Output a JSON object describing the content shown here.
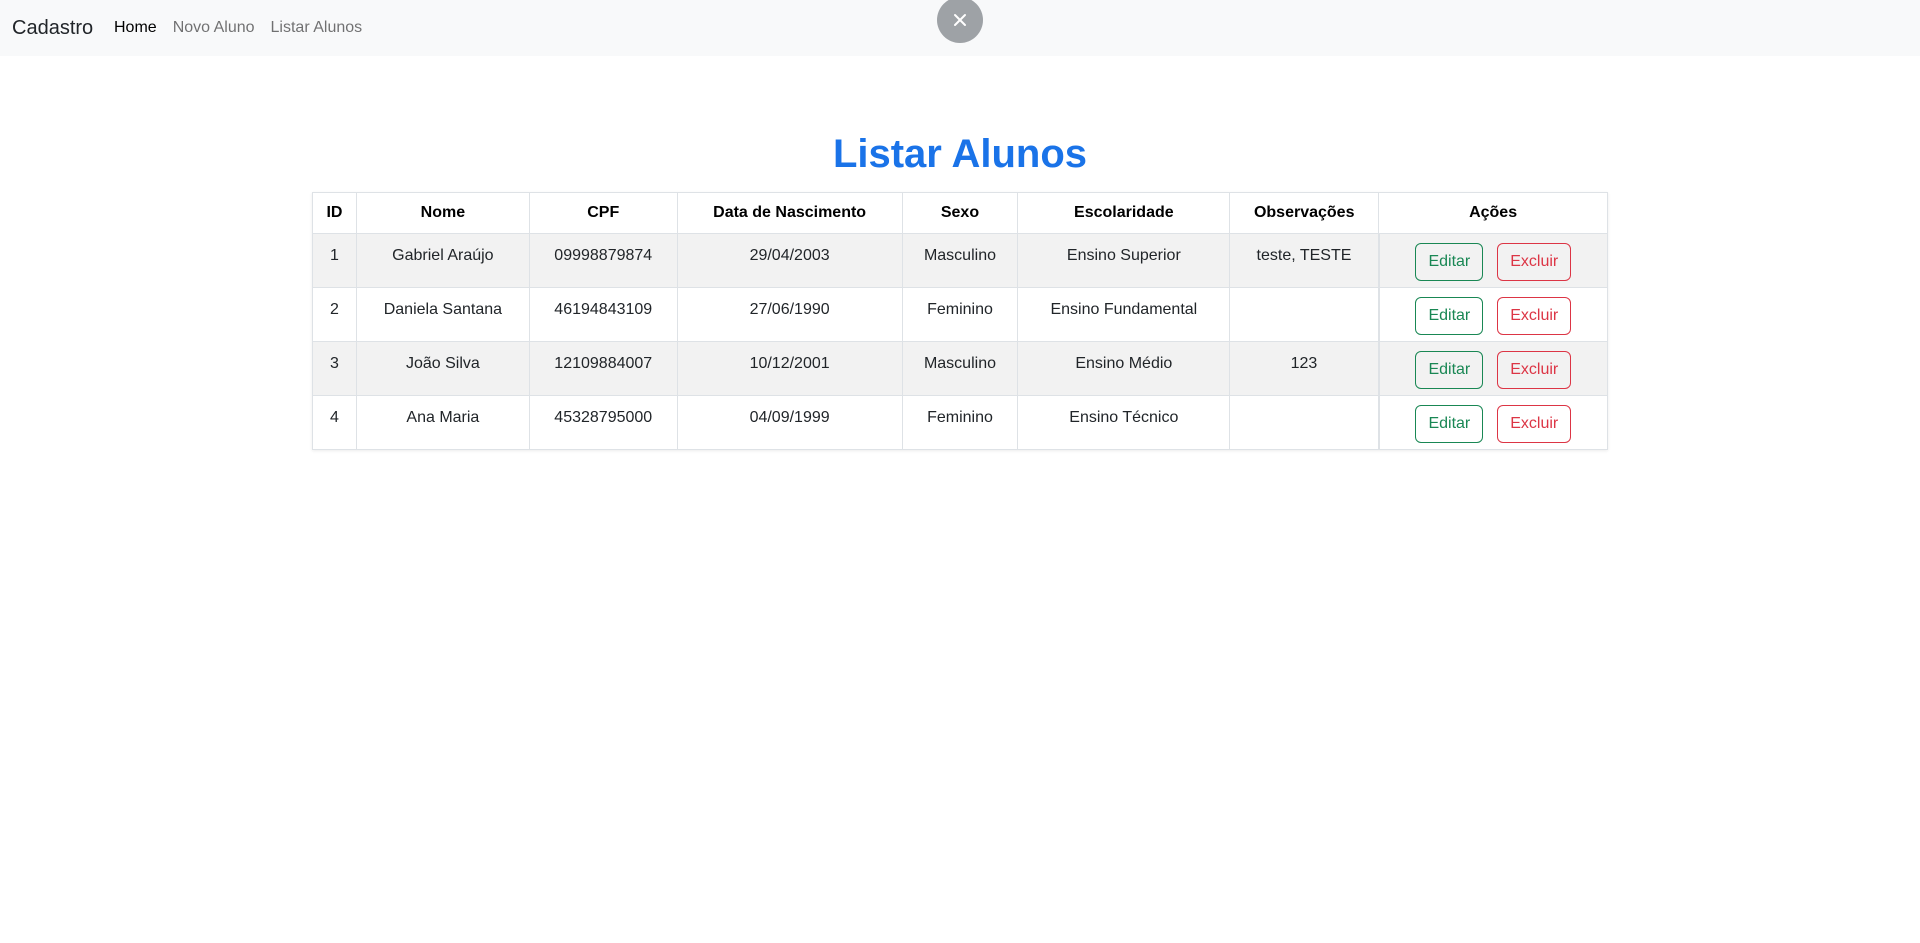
{
  "navbar": {
    "brand": "Cadastro",
    "links": [
      {
        "label": "Home",
        "active": true
      },
      {
        "label": "Novo Aluno",
        "active": false
      },
      {
        "label": "Listar Alunos",
        "active": false
      }
    ]
  },
  "overlay": {
    "close_icon": "close-icon"
  },
  "page": {
    "title": "Listar Alunos"
  },
  "table": {
    "headers": [
      "ID",
      "Nome",
      "CPF",
      "Data de Nascimento",
      "Sexo",
      "Escolaridade",
      "Observações",
      "Ações"
    ],
    "rows": [
      {
        "id": "1",
        "nome": "Gabriel Araújo",
        "cpf": "09998879874",
        "nascimento": "29/04/2003",
        "sexo": "Masculino",
        "escolaridade": "Ensino Superior",
        "observacoes": "teste, TESTE"
      },
      {
        "id": "2",
        "nome": "Daniela Santana",
        "cpf": "46194843109",
        "nascimento": "27/06/1990",
        "sexo": "Feminino",
        "escolaridade": "Ensino Fundamental",
        "observacoes": ""
      },
      {
        "id": "3",
        "nome": "João Silva",
        "cpf": "12109884007",
        "nascimento": "10/12/2001",
        "sexo": "Masculino",
        "escolaridade": "Ensino Médio",
        "observacoes": "123"
      },
      {
        "id": "4",
        "nome": "Ana Maria",
        "cpf": "45328795000",
        "nascimento": "04/09/1999",
        "sexo": "Feminino",
        "escolaridade": "Ensino Técnico",
        "observacoes": ""
      }
    ],
    "edit_label": "Editar",
    "delete_label": "Excluir"
  },
  "colors": {
    "title": "#1a73e8",
    "edit": "#198754",
    "delete": "#dc3545",
    "navbar_bg": "#f8f9fa",
    "stripe": "#f2f2f2"
  }
}
